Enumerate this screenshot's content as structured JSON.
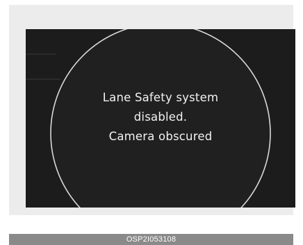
{
  "display": {
    "message_line1": "Lane Safety system",
    "message_line2": "disabled.",
    "message_line3": "Camera obscured",
    "background_color": "#1c1c1c",
    "text_color": "#f2f2f2"
  },
  "caption": {
    "code": "OSP2I053108"
  }
}
